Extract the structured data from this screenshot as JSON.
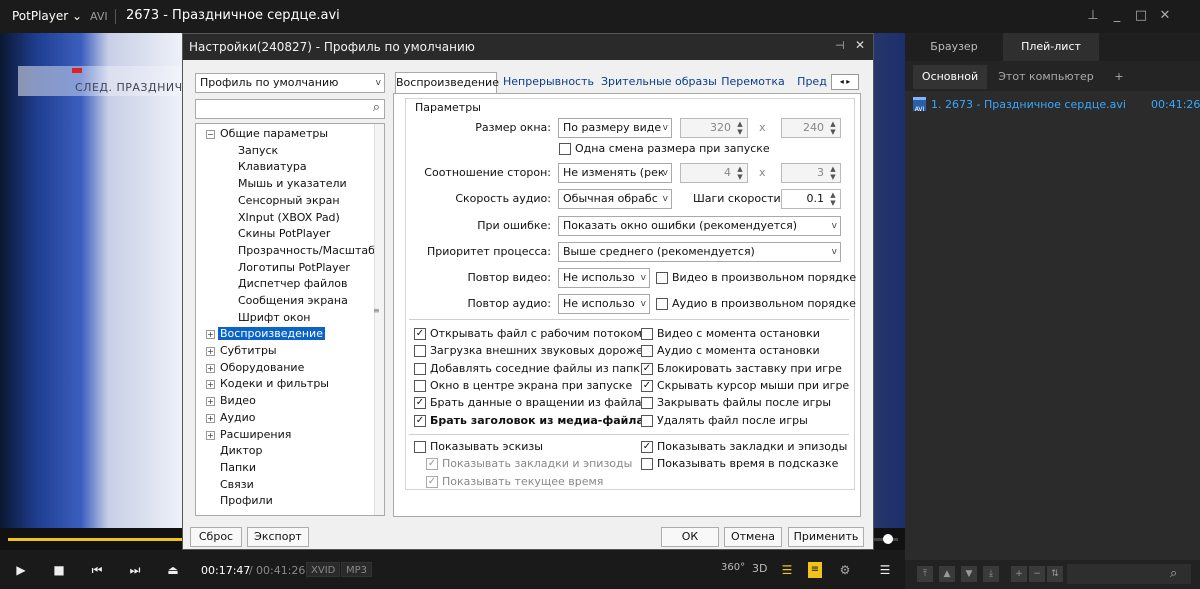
{
  "titlebar": {
    "app": "PotPlayer ⌄",
    "format": "AVI",
    "title": "2673 - Праздничное сердце.avi"
  },
  "video": {
    "banner_text": "СЛЕД. ПРАЗДНИЧ"
  },
  "controls": {
    "current_time": "00:17:47",
    "separator": "/",
    "total_time": "00:41:26",
    "video_codec": "XVID",
    "audio_codec": "MP3",
    "label_360": "360°",
    "label_3d": "3D",
    "progress": 0.195
  },
  "right_panel": {
    "tabs": [
      "Браузер",
      "Плей-лист"
    ],
    "subtabs": [
      "Основной",
      "Этот компьютер",
      "+"
    ],
    "item": {
      "icon": "AVI",
      "label": "1. 2673 - Праздничное сердце.avi",
      "duration": "00:41:26"
    }
  },
  "dialog": {
    "title": "Настройки(240827) - Профиль по умолчанию",
    "profile": "Профиль по умолчанию",
    "search_placeholder": "",
    "tree": {
      "general": "Общие параметры",
      "general_children": [
        "Запуск",
        "Клавиатура",
        "Мышь и указатели",
        "Сенсорный экран",
        "XInput (XBOX Pad)",
        "Скины PotPlayer",
        "Прозрачность/Масштаб",
        "Логотипы PotPlayer",
        "Диспетчер файлов",
        "Сообщения экрана",
        "Шрифт окон"
      ],
      "others": [
        "Воспроизведение",
        "Субтитры",
        "Оборудование",
        "Кодеки и фильтры",
        "Видео",
        "Аудио",
        "Расширения",
        "Диктор",
        "Папки",
        "Связи",
        "Профили"
      ]
    },
    "tabs": [
      "Воспроизведение",
      "Непрерывность",
      "Зрительные образы",
      "Перемотка",
      "Пред"
    ],
    "group_title": "Параметры",
    "labels": {
      "window_size": "Размер окна:",
      "aspect": "Соотношение сторон:",
      "audio_speed": "Скорость аудио:",
      "speed_step": "Шаги скорости:",
      "on_error": "При ошибке:",
      "priority": "Приоритет процесса:",
      "repeat_video": "Повтор видео:",
      "repeat_audio": "Повтор аудио:",
      "x": "x"
    },
    "values": {
      "window_size": "По размеру виде",
      "w": "320",
      "h": "240",
      "aspect": "Не изменять (рек",
      "aw": "4",
      "ah": "3",
      "audio_speed": "Обычная обрабс",
      "speed_step": "0.1",
      "on_error": "Показать окно ошибки (рекомендуется)",
      "priority": "Выше среднего (рекомендуется)",
      "repeat_video": "Не использо",
      "repeat_audio": "Не использо"
    },
    "checks": {
      "single_resize": {
        "label": "Одна смена размера при запуске",
        "checked": false
      },
      "video_random": {
        "label": "Видео в произвольном порядке",
        "checked": false
      },
      "audio_random": {
        "label": "Аудио в произвольном порядке",
        "checked": false
      },
      "left": [
        {
          "label": "Открывать файл с рабочим потоком",
          "checked": true
        },
        {
          "label": "Загрузка внешних звуковых дорожек",
          "checked": false
        },
        {
          "label": "Добавлять соседние файлы из папки",
          "checked": false
        },
        {
          "label": "Окно в центре экрана при запуске",
          "checked": false
        },
        {
          "label": "Брать данные о вращении из файла",
          "checked": true
        },
        {
          "label": "Брать заголовок из медиа-файла",
          "checked": true
        }
      ],
      "right": [
        {
          "label": "Видео с момента остановки",
          "checked": false
        },
        {
          "label": "Аудио с момента остановки",
          "checked": false
        },
        {
          "label": "Блокировать заставку при игре",
          "checked": true
        },
        {
          "label": "Скрывать курсор мыши при игре",
          "checked": true
        },
        {
          "label": "Закрывать файлы после игры",
          "checked": false
        },
        {
          "label": "Удалять файл после игры",
          "checked": false
        }
      ],
      "thumbs": {
        "label": "Показывать эскизы",
        "checked": false
      },
      "thumbs_bookmarks": {
        "label": "Показывать закладки и эпизоды",
        "checked": true
      },
      "thumbs_time": {
        "label": "Показывать текущее время",
        "checked": true
      },
      "bookmarks": {
        "label": "Показывать закладки и эпизоды",
        "checked": true
      },
      "tooltip_time": {
        "label": "Показывать время в подсказке",
        "checked": false
      }
    },
    "buttons": {
      "reset": "Сброс",
      "export": "Экспорт",
      "ok": "ОК",
      "cancel": "Отмена",
      "apply": "Применить"
    }
  }
}
